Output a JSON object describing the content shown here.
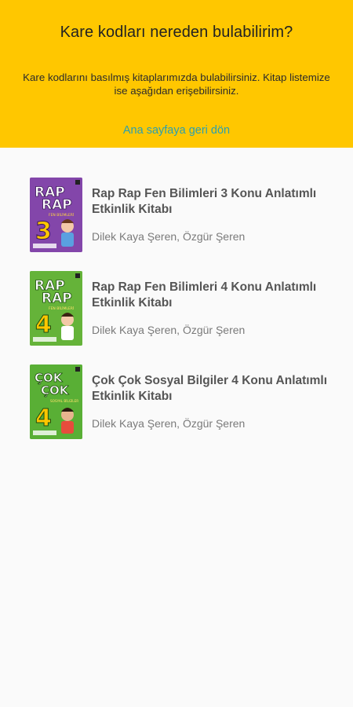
{
  "header": {
    "title": "Kare kodları nereden bulabilirim?",
    "description": "Kare kodlarını basılmış kitaplarımızda bulabilirsiniz. Kitap listemize ise aşağıdan erişebilirsiniz.",
    "back_link": "Ana sayfaya geri dön"
  },
  "colors": {
    "header_bg": "#ffc700",
    "link": "#2a9fb0",
    "cover_purple": "#7a3fa0",
    "cover_green": "#5aa632"
  },
  "books": [
    {
      "title": "Rap Rap Fen Bilimleri 3 Konu Anlatımlı Etkinlik Kitabı",
      "authors": "Dilek Kaya Şeren, Özgür Şeren",
      "cover": {
        "line1": "RAP",
        "line2": "RAP",
        "grade": "3",
        "subtitle": "FEN BİLİMLERİ"
      }
    },
    {
      "title": "Rap Rap Fen Bilimleri 4 Konu Anlatımlı Etkinlik Kitabı",
      "authors": "Dilek Kaya Şeren, Özgür Şeren",
      "cover": {
        "line1": "RAP",
        "line2": "RAP",
        "grade": "4",
        "subtitle": "FEN BİLİMLERİ"
      }
    },
    {
      "title": "Çok Çok Sosyal Bilgiler 4 Konu Anlatımlı Etkinlik Kitabı",
      "authors": "Dilek Kaya Şeren, Özgür Şeren",
      "cover": {
        "line1": "ÇOK",
        "line2": "ÇOK",
        "grade": "4",
        "subtitle": "SOSYAL BİLGİLER"
      }
    }
  ]
}
